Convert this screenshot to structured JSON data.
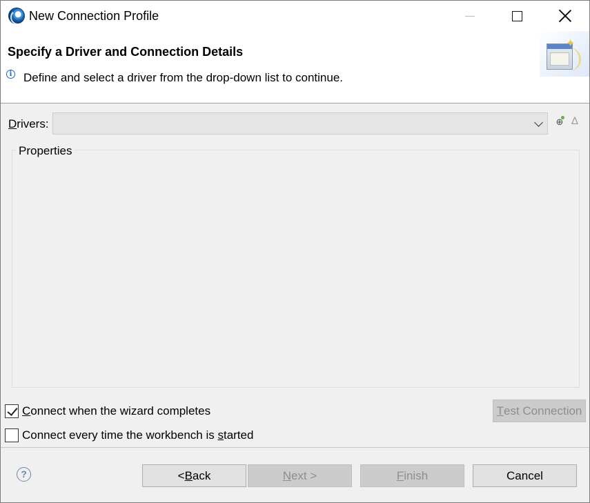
{
  "window": {
    "title": "New Connection Profile"
  },
  "banner": {
    "title": "Specify a Driver and Connection Details",
    "description": "Define and select a driver from the drop-down list to continue."
  },
  "drivers": {
    "label_prefix": "D",
    "label_rest": "rivers:",
    "selected_value": ""
  },
  "properties": {
    "legend": "Properties"
  },
  "options": {
    "connect_on_complete": {
      "label_prefix": "C",
      "label_rest": "onnect when the wizard completes",
      "checked": true
    },
    "connect_on_start": {
      "label_before": "Connect every time the workbench is ",
      "label_underlined": "s",
      "label_after": "tarted",
      "checked": false
    }
  },
  "buttons": {
    "test_connection_prefix": "T",
    "test_connection_rest": "est Connection",
    "back_before": "< ",
    "back_underlined": "B",
    "back_after": "ack",
    "next_underlined": "N",
    "next_after": "ext >",
    "finish_underlined": "F",
    "finish_after": "inish",
    "cancel": "Cancel"
  },
  "icons": {
    "app": "eclipse-icon",
    "info": "info-icon",
    "new_driver": "new-driver-icon",
    "edit_driver": "edit-driver-icon",
    "help": "help-icon"
  }
}
